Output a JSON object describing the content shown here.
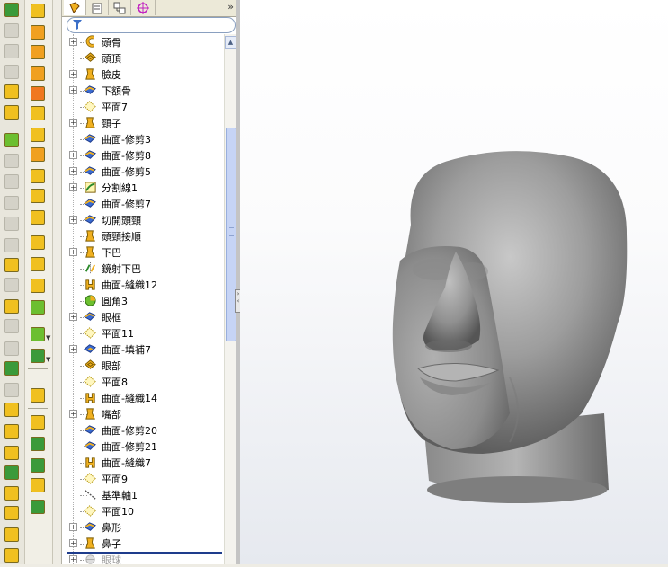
{
  "colors": {
    "part_gray": "#9a9a9a",
    "feature_yellow": "#f0c020",
    "rollback_bar": "#1e3c8c"
  },
  "left_toolbar": {
    "icons": [
      "sketch-icon",
      "smart-dimension-icon",
      "line-icon",
      "circle-icon",
      "arc-icon",
      "spline-icon",
      "rectangle-icon",
      "polygon-icon",
      "centerline-icon",
      "trim-icon",
      "extend-icon",
      "offset-icon",
      "mirror-icon",
      "pattern-icon",
      "fillet-icon",
      "chamfer-icon",
      "construction-icon",
      "display-icon",
      "rebuild-icon",
      "options-icon",
      "pan-icon",
      "zoom-icon",
      "rotate-icon",
      "section-icon",
      "view-icon",
      "render-icon",
      "exit-icon"
    ]
  },
  "feature_toolbar": {
    "icons": [
      "boss-extrude-icon",
      "revolve-icon",
      "sweep-icon",
      "loft-icon",
      "surface-extrude-icon",
      "surface-planar-icon",
      "offset-surface-icon",
      "fill-surface-icon",
      "knit-surface-icon",
      "trim-surface-icon",
      "untrim-surface-icon",
      "delete-face-icon",
      "thicken-icon",
      "move-face-icon",
      "replace-face-icon",
      "split-line-icon",
      "curve-icon",
      "3d-sketch-icon",
      "projected-curve-icon",
      "helix-icon",
      "composite-curve-icon",
      "intersection-curve-icon",
      "ruled-surface-icon"
    ]
  },
  "fm_tabs": {
    "icons": [
      "feature-manager-icon",
      "property-manager-icon",
      "configuration-manager-icon",
      "dimxpert-icon"
    ],
    "expand": "»"
  },
  "tree": {
    "items": [
      {
        "label": "頭骨",
        "expandable": true,
        "icon": "revolve-surface-icon"
      },
      {
        "label": "頭頂",
        "expandable": false,
        "icon": "surface-icon"
      },
      {
        "label": "臉皮",
        "expandable": true,
        "icon": "loft-surface-icon"
      },
      {
        "label": "下額骨",
        "expandable": true,
        "icon": "trim-surface-icon"
      },
      {
        "label": "平面7",
        "expandable": false,
        "icon": "plane-icon"
      },
      {
        "label": "頸子",
        "expandable": true,
        "icon": "loft-surface-icon"
      },
      {
        "label": "曲面-修剪3",
        "expandable": false,
        "icon": "trim-surface-icon"
      },
      {
        "label": "曲面-修剪8",
        "expandable": true,
        "icon": "trim-surface-icon"
      },
      {
        "label": "曲面-修剪5",
        "expandable": true,
        "icon": "trim-surface-icon"
      },
      {
        "label": "分割線1",
        "expandable": true,
        "icon": "split-line-icon"
      },
      {
        "label": "曲面-修剪7",
        "expandable": false,
        "icon": "trim-surface-icon"
      },
      {
        "label": "切開頭頸",
        "expandable": true,
        "icon": "trim-surface-icon"
      },
      {
        "label": "頭頸接順",
        "expandable": false,
        "icon": "loft-surface-icon"
      },
      {
        "label": "下巴",
        "expandable": true,
        "icon": "loft-surface-icon"
      },
      {
        "label": "鏡射下巴",
        "expandable": false,
        "icon": "mirror-icon"
      },
      {
        "label": "曲面-縫織12",
        "expandable": false,
        "icon": "knit-surface-icon"
      },
      {
        "label": "圓角3",
        "expandable": false,
        "icon": "fillet-icon"
      },
      {
        "label": "眼框",
        "expandable": true,
        "icon": "trim-surface-icon"
      },
      {
        "label": "平面11",
        "expandable": false,
        "icon": "plane-icon"
      },
      {
        "label": "曲面-填補7",
        "expandable": true,
        "icon": "fill-surface-icon"
      },
      {
        "label": "眼部",
        "expandable": false,
        "icon": "surface-icon"
      },
      {
        "label": "平面8",
        "expandable": false,
        "icon": "plane-icon"
      },
      {
        "label": "曲面-縫織14",
        "expandable": false,
        "icon": "knit-surface-icon"
      },
      {
        "label": "嘴部",
        "expandable": true,
        "icon": "loft-surface-icon"
      },
      {
        "label": "曲面-修剪20",
        "expandable": false,
        "icon": "trim-surface-icon"
      },
      {
        "label": "曲面-修剪21",
        "expandable": false,
        "icon": "trim-surface-icon"
      },
      {
        "label": "曲面-縫織7",
        "expandable": false,
        "icon": "knit-surface-icon"
      },
      {
        "label": "平面9",
        "expandable": false,
        "icon": "plane-icon"
      },
      {
        "label": "基準軸1",
        "expandable": false,
        "icon": "axis-icon"
      },
      {
        "label": "平面10",
        "expandable": false,
        "icon": "plane-icon"
      },
      {
        "label": "鼻形",
        "expandable": true,
        "icon": "trim-surface-icon"
      },
      {
        "label": "鼻子",
        "expandable": true,
        "icon": "loft-surface-icon"
      },
      {
        "label": "眼球",
        "expandable": true,
        "icon": "suppressed-icon",
        "suppressed": true
      }
    ]
  }
}
